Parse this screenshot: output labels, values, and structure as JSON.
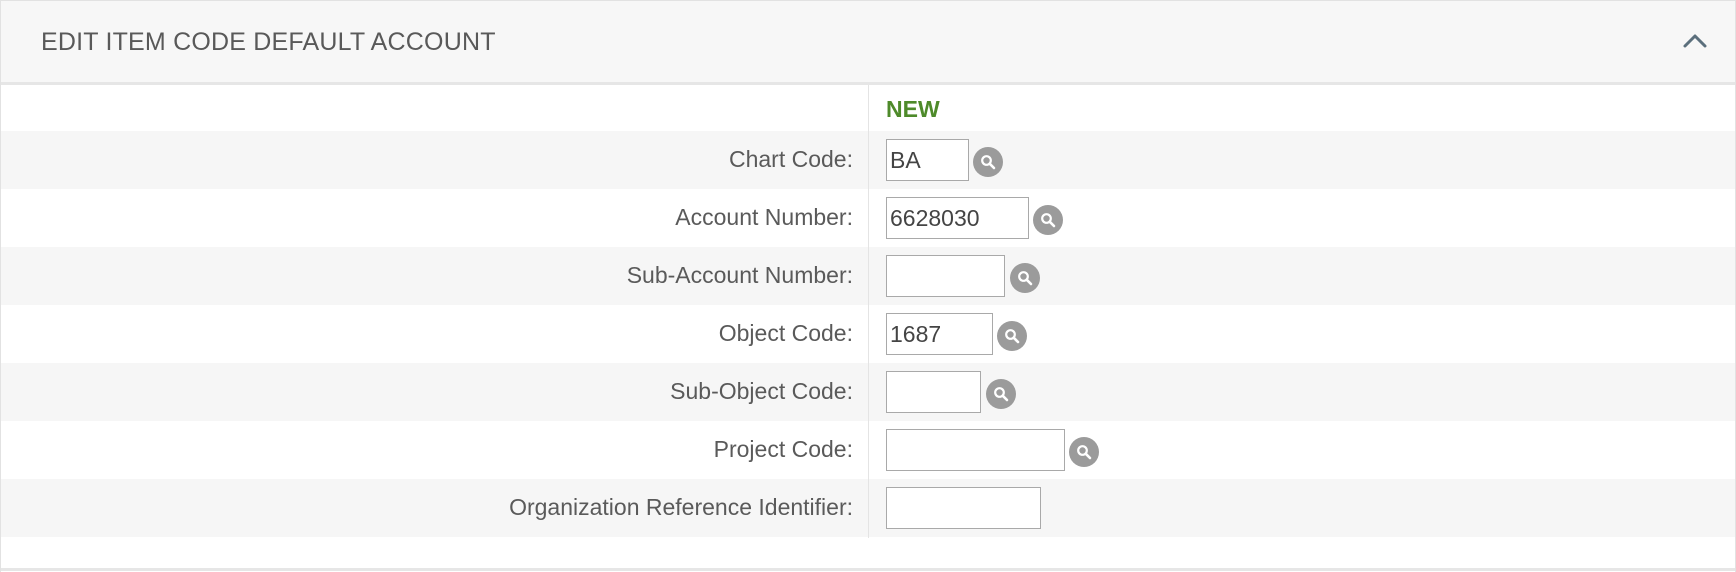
{
  "panel": {
    "title": "EDIT ITEM CODE DEFAULT ACCOUNT",
    "collapse_icon": "chevron-up-icon"
  },
  "status": {
    "label": "NEW",
    "color": "#4e8a2a"
  },
  "fields": {
    "chart_code": {
      "label": "Chart Code:",
      "value": "BA",
      "lookup_icon": "search-icon"
    },
    "account_number": {
      "label": "Account Number:",
      "value": "6628030",
      "lookup_icon": "search-icon"
    },
    "sub_account_number": {
      "label": "Sub-Account Number:",
      "value": "",
      "lookup_icon": "search-icon"
    },
    "object_code": {
      "label": "Object Code:",
      "value": "1687",
      "lookup_icon": "search-icon"
    },
    "sub_object_code": {
      "label": "Sub-Object Code:",
      "value": "",
      "lookup_icon": "search-icon"
    },
    "project_code": {
      "label": "Project Code:",
      "value": "",
      "lookup_icon": "search-icon"
    },
    "org_ref_id": {
      "label": "Organization Reference Identifier:",
      "value": ""
    }
  }
}
